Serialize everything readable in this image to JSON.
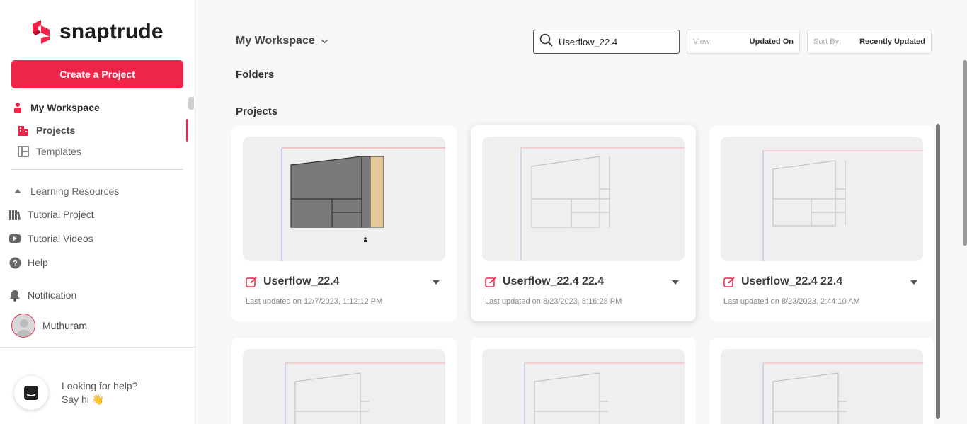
{
  "brand": {
    "name": "snaptrude",
    "color": "#ee2548"
  },
  "sidebar": {
    "create_button": "Create a Project",
    "workspace": "My Workspace",
    "projects": "Projects",
    "templates": "Templates",
    "learning": "Learning Resources",
    "tutorial_project": "Tutorial Project",
    "tutorial_videos": "Tutorial Videos",
    "help": "Help",
    "notification": "Notification",
    "user_name": "Muthuram",
    "help_widget": {
      "line1": "Looking for help?",
      "line2": "Say hi 👋"
    }
  },
  "header": {
    "workspace_title": "My Workspace",
    "search_value": "Userflow_22.4",
    "view_label": "View:",
    "view_value": "Updated On",
    "sort_label": "Sort By:",
    "sort_value": "Recently Updated"
  },
  "sections": {
    "folders": "Folders",
    "projects": "Projects"
  },
  "projects": [
    {
      "title": "Userflow_22.4",
      "updated": "Last updated on 12/7/2023, 1:12:12 PM"
    },
    {
      "title": "Userflow_22.4 22.4",
      "updated": "Last updated on 8/23/2023, 8:16:28 PM"
    },
    {
      "title": "Userflow_22.4 22.4",
      "updated": "Last updated on 8/23/2023, 2:44:10 AM"
    }
  ]
}
